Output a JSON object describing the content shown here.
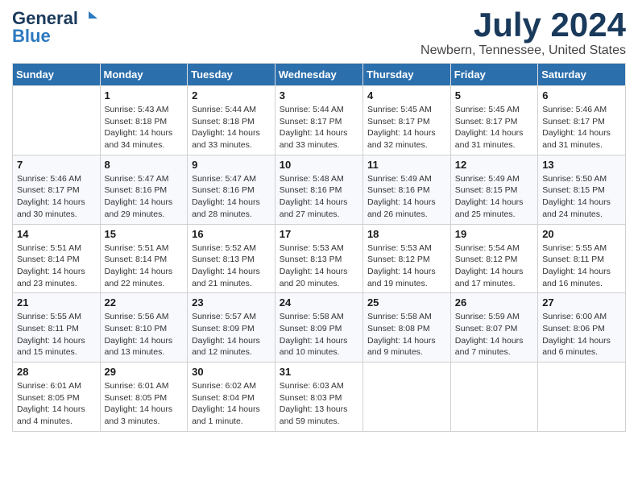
{
  "header": {
    "logo": {
      "line1": "General",
      "line2": "Blue"
    },
    "month": "July 2024",
    "location": "Newbern, Tennessee, United States"
  },
  "weekdays": [
    "Sunday",
    "Monday",
    "Tuesday",
    "Wednesday",
    "Thursday",
    "Friday",
    "Saturday"
  ],
  "weeks": [
    [
      {
        "date": "",
        "info": ""
      },
      {
        "date": "1",
        "info": "Sunrise: 5:43 AM\nSunset: 8:18 PM\nDaylight: 14 hours\nand 34 minutes."
      },
      {
        "date": "2",
        "info": "Sunrise: 5:44 AM\nSunset: 8:18 PM\nDaylight: 14 hours\nand 33 minutes."
      },
      {
        "date": "3",
        "info": "Sunrise: 5:44 AM\nSunset: 8:17 PM\nDaylight: 14 hours\nand 33 minutes."
      },
      {
        "date": "4",
        "info": "Sunrise: 5:45 AM\nSunset: 8:17 PM\nDaylight: 14 hours\nand 32 minutes."
      },
      {
        "date": "5",
        "info": "Sunrise: 5:45 AM\nSunset: 8:17 PM\nDaylight: 14 hours\nand 31 minutes."
      },
      {
        "date": "6",
        "info": "Sunrise: 5:46 AM\nSunset: 8:17 PM\nDaylight: 14 hours\nand 31 minutes."
      }
    ],
    [
      {
        "date": "7",
        "info": "Sunrise: 5:46 AM\nSunset: 8:17 PM\nDaylight: 14 hours\nand 30 minutes."
      },
      {
        "date": "8",
        "info": "Sunrise: 5:47 AM\nSunset: 8:16 PM\nDaylight: 14 hours\nand 29 minutes."
      },
      {
        "date": "9",
        "info": "Sunrise: 5:47 AM\nSunset: 8:16 PM\nDaylight: 14 hours\nand 28 minutes."
      },
      {
        "date": "10",
        "info": "Sunrise: 5:48 AM\nSunset: 8:16 PM\nDaylight: 14 hours\nand 27 minutes."
      },
      {
        "date": "11",
        "info": "Sunrise: 5:49 AM\nSunset: 8:16 PM\nDaylight: 14 hours\nand 26 minutes."
      },
      {
        "date": "12",
        "info": "Sunrise: 5:49 AM\nSunset: 8:15 PM\nDaylight: 14 hours\nand 25 minutes."
      },
      {
        "date": "13",
        "info": "Sunrise: 5:50 AM\nSunset: 8:15 PM\nDaylight: 14 hours\nand 24 minutes."
      }
    ],
    [
      {
        "date": "14",
        "info": "Sunrise: 5:51 AM\nSunset: 8:14 PM\nDaylight: 14 hours\nand 23 minutes."
      },
      {
        "date": "15",
        "info": "Sunrise: 5:51 AM\nSunset: 8:14 PM\nDaylight: 14 hours\nand 22 minutes."
      },
      {
        "date": "16",
        "info": "Sunrise: 5:52 AM\nSunset: 8:13 PM\nDaylight: 14 hours\nand 21 minutes."
      },
      {
        "date": "17",
        "info": "Sunrise: 5:53 AM\nSunset: 8:13 PM\nDaylight: 14 hours\nand 20 minutes."
      },
      {
        "date": "18",
        "info": "Sunrise: 5:53 AM\nSunset: 8:12 PM\nDaylight: 14 hours\nand 19 minutes."
      },
      {
        "date": "19",
        "info": "Sunrise: 5:54 AM\nSunset: 8:12 PM\nDaylight: 14 hours\nand 17 minutes."
      },
      {
        "date": "20",
        "info": "Sunrise: 5:55 AM\nSunset: 8:11 PM\nDaylight: 14 hours\nand 16 minutes."
      }
    ],
    [
      {
        "date": "21",
        "info": "Sunrise: 5:55 AM\nSunset: 8:11 PM\nDaylight: 14 hours\nand 15 minutes."
      },
      {
        "date": "22",
        "info": "Sunrise: 5:56 AM\nSunset: 8:10 PM\nDaylight: 14 hours\nand 13 minutes."
      },
      {
        "date": "23",
        "info": "Sunrise: 5:57 AM\nSunset: 8:09 PM\nDaylight: 14 hours\nand 12 minutes."
      },
      {
        "date": "24",
        "info": "Sunrise: 5:58 AM\nSunset: 8:09 PM\nDaylight: 14 hours\nand 10 minutes."
      },
      {
        "date": "25",
        "info": "Sunrise: 5:58 AM\nSunset: 8:08 PM\nDaylight: 14 hours\nand 9 minutes."
      },
      {
        "date": "26",
        "info": "Sunrise: 5:59 AM\nSunset: 8:07 PM\nDaylight: 14 hours\nand 7 minutes."
      },
      {
        "date": "27",
        "info": "Sunrise: 6:00 AM\nSunset: 8:06 PM\nDaylight: 14 hours\nand 6 minutes."
      }
    ],
    [
      {
        "date": "28",
        "info": "Sunrise: 6:01 AM\nSunset: 8:05 PM\nDaylight: 14 hours\nand 4 minutes."
      },
      {
        "date": "29",
        "info": "Sunrise: 6:01 AM\nSunset: 8:05 PM\nDaylight: 14 hours\nand 3 minutes."
      },
      {
        "date": "30",
        "info": "Sunrise: 6:02 AM\nSunset: 8:04 PM\nDaylight: 14 hours\nand 1 minute."
      },
      {
        "date": "31",
        "info": "Sunrise: 6:03 AM\nSunset: 8:03 PM\nDaylight: 13 hours\nand 59 minutes."
      },
      {
        "date": "",
        "info": ""
      },
      {
        "date": "",
        "info": ""
      },
      {
        "date": "",
        "info": ""
      }
    ]
  ]
}
